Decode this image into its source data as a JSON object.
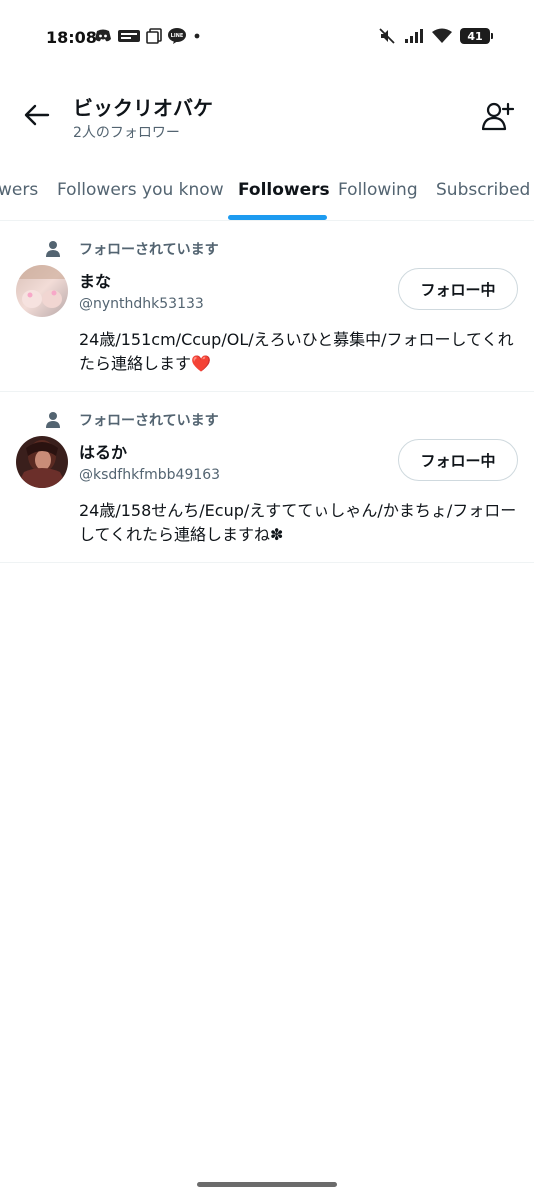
{
  "status_bar": {
    "time": "18:08",
    "battery": "41",
    "left_icons": [
      "discord-icon",
      "app-badge-icon",
      "copy-icon",
      "line-icon",
      "dot-icon"
    ],
    "right_icons": [
      "mute-icon",
      "signal-icon",
      "wifi-icon",
      "battery-icon"
    ]
  },
  "header": {
    "title": "ビックリオバケ",
    "subtitle": "2人のフォロワー",
    "back_icon": "arrow-left-icon",
    "add_icon": "add-user-icon"
  },
  "tabs": [
    {
      "label": "wers",
      "active": false
    },
    {
      "label": "Followers you know",
      "active": false
    },
    {
      "label": "Followers",
      "active": true
    },
    {
      "label": "Following",
      "active": false
    },
    {
      "label": "Subscribed",
      "active": false
    }
  ],
  "accent_color": "#1d9bf0",
  "followers": [
    {
      "context": "フォローされています",
      "name": "まな",
      "handle": "@nynthdhk53133",
      "bio": "24歳/151cm/Ccup/OL/えろいひと募集中/フォローしてくれたら連絡します❤️",
      "button": "フォロー中"
    },
    {
      "context": "フォローされています",
      "name": "はるか",
      "handle": "@ksdfhkfmbb49163",
      "bio": "24歳/158せんち/Ecup/えすててぃしゃん/かまちょ/フォローしてくれたら連絡しますね✽",
      "button": "フォロー中"
    }
  ]
}
